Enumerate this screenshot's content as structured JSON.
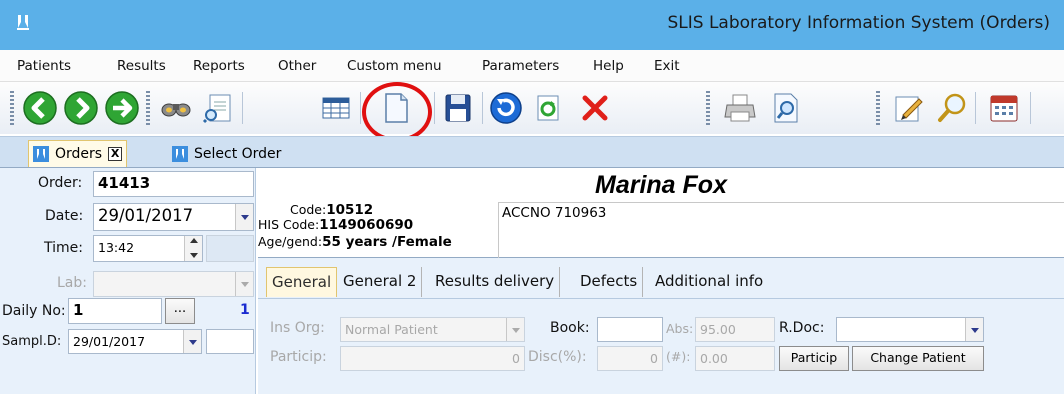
{
  "window": {
    "title": "SLIS Laboratory Information System (Orders)"
  },
  "menu": [
    "Patients",
    "Results",
    "Reports",
    "Other",
    "Custom menu",
    "Parameters",
    "Help",
    "Exit"
  ],
  "toolbar": {
    "icons": [
      "back-icon",
      "forward-icon",
      "next-icon",
      "binoculars-icon",
      "document-search-icon",
      "table-icon",
      "new-document-icon",
      "save-icon",
      "undo-icon",
      "refresh-icon",
      "delete-icon",
      "printer-icon",
      "print-preview-icon",
      "edit-icon",
      "magnifier-icon",
      "calendar-icon"
    ],
    "highlighted": "new-document-icon",
    "highlight_color": "#e01010"
  },
  "doc_tabs": {
    "orders": "Orders",
    "close": "X",
    "select_order": "Select Order"
  },
  "order": {
    "order_label": "Order:",
    "order_value": "41413",
    "date_label": "Date:",
    "date_value": "29/01/2017",
    "time_label": "Time:",
    "time_value": "13:42",
    "lab_label": "Lab:",
    "lab_value": "",
    "daily_no_label": "Daily No:",
    "daily_no_value": "1",
    "daily_no_button": "...",
    "daily_no_count": "1",
    "sampl_d_label": "Sampl.D:",
    "sampl_d_value": "29/01/2017"
  },
  "patient": {
    "name": "Marina Fox",
    "code_label": "Code:",
    "code_value": "10512",
    "his_code_label": "HIS Code:",
    "his_code_value": "1149060690",
    "age_label": "Age/gend:",
    "age_value": "55 years /Female",
    "accno": "ACCNO 710963"
  },
  "section_tabs": [
    "General",
    "General 2",
    "Results delivery",
    "Defects",
    "Additional info"
  ],
  "general": {
    "ins_org_label": "Ins Org:",
    "ins_org_value": "Normal Patient",
    "book_label": "Book:",
    "book_value": "",
    "abs_label": "Abs:",
    "abs_value": "95.00",
    "rdoc_label": "R.Doc:",
    "rdoc_value": "",
    "particip_label": "Particip:",
    "particip_value": "0",
    "disc_label": "Disc(%):",
    "disc_value": "0",
    "hash_label": "(#):",
    "hash_value": "0.00",
    "particip_button": "Particip",
    "change_patient_button": "Change Patient"
  },
  "colors": {
    "titlebar": "#5bb0e8",
    "panel": "#e8f1fb",
    "daily_count": "#1a2bd0"
  }
}
